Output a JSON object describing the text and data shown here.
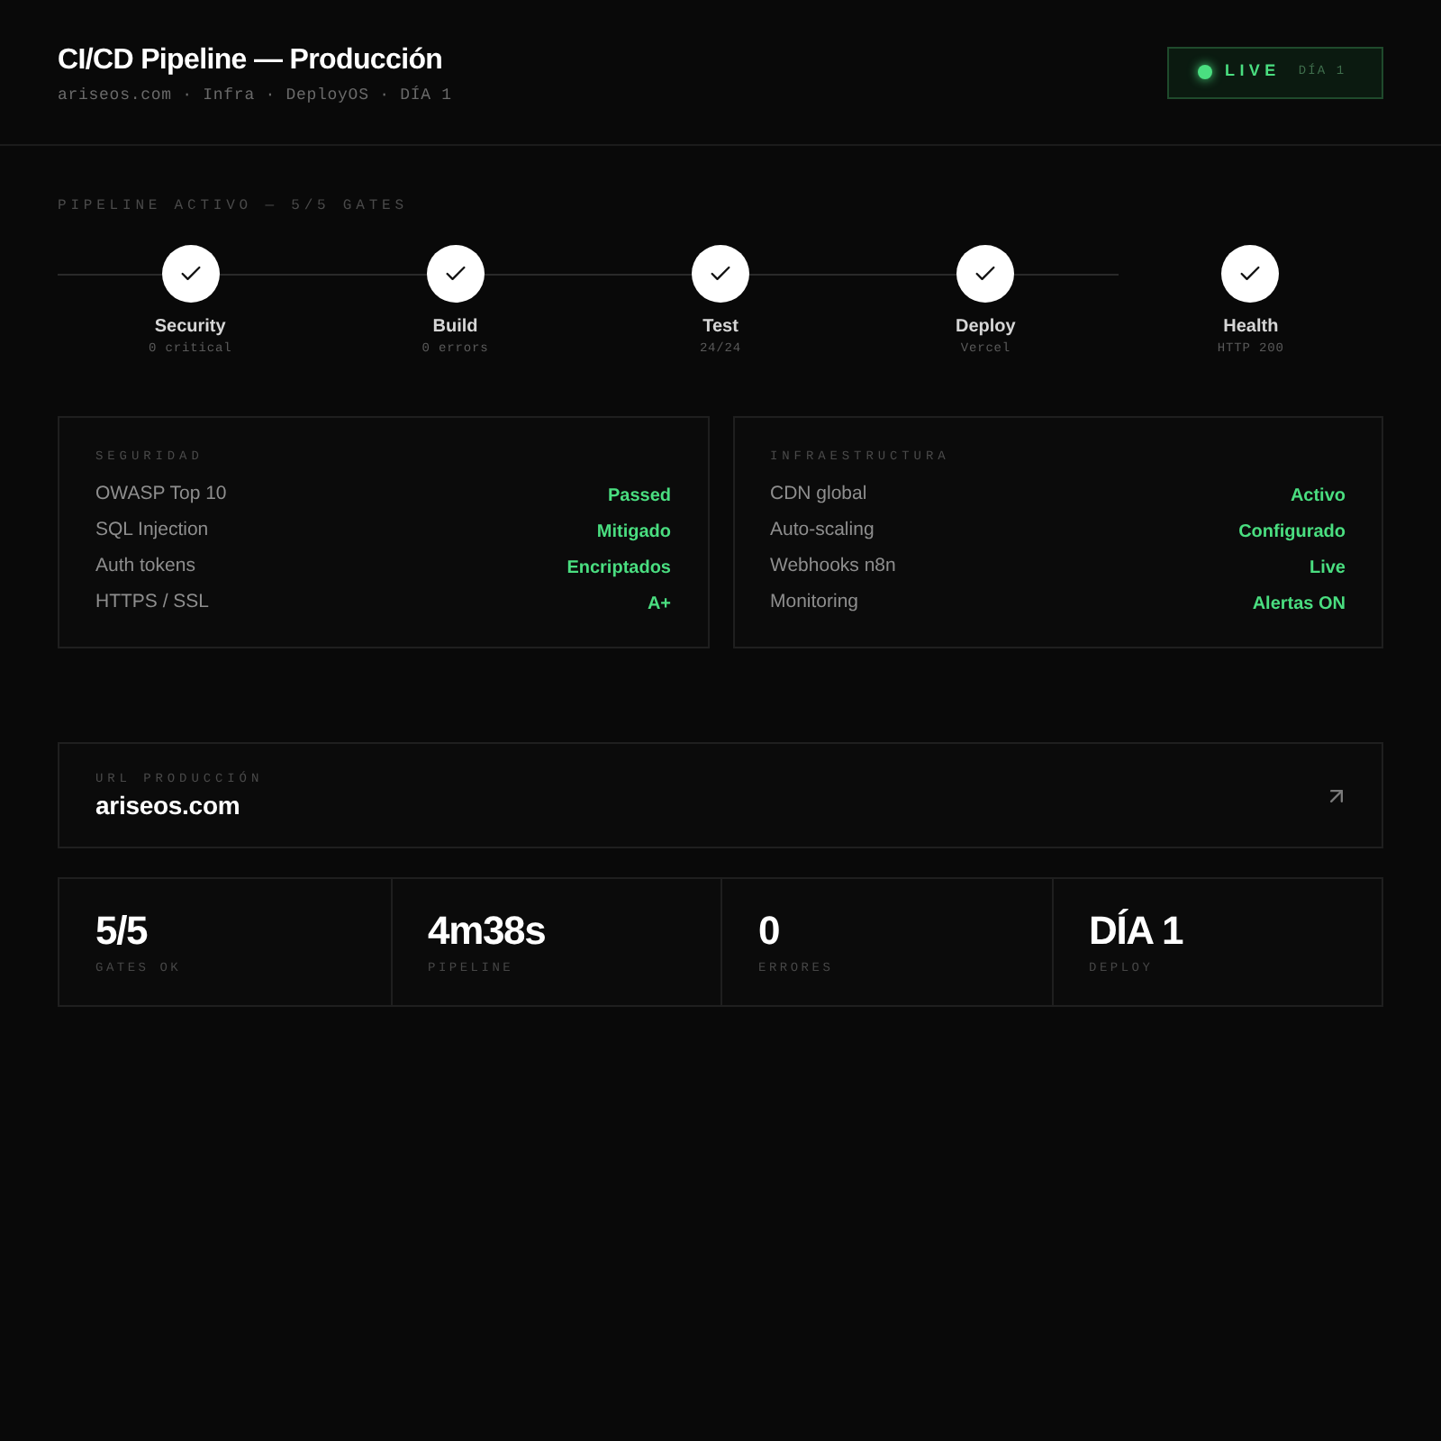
{
  "header": {
    "title": "CI/CD Pipeline — Producción",
    "subtitle": "ariseos.com · Infra · DeployOS · DÍA 1",
    "status_badge": {
      "label": "LIVE",
      "detail": "DÍA 1"
    }
  },
  "pipeline": {
    "heading": "PIPELINE ACTIVO — 5/5 GATES",
    "gates": [
      {
        "name": "Security",
        "detail": "0 critical",
        "passed": true
      },
      {
        "name": "Build",
        "detail": "0 errors",
        "passed": true
      },
      {
        "name": "Test",
        "detail": "24/24",
        "passed": true
      },
      {
        "name": "Deploy",
        "detail": "Vercel",
        "passed": true
      },
      {
        "name": "Health",
        "detail": "HTTP 200",
        "passed": true
      }
    ]
  },
  "panels": [
    {
      "title": "SEGURIDAD",
      "rows": [
        {
          "label": "OWASP Top 10",
          "value": "Passed"
        },
        {
          "label": "SQL Injection",
          "value": "Mitigado"
        },
        {
          "label": "Auth tokens",
          "value": "Encriptados"
        },
        {
          "label": "HTTPS / SSL",
          "value": "A+"
        }
      ]
    },
    {
      "title": "INFRAESTRUCTURA",
      "rows": [
        {
          "label": "CDN global",
          "value": "Activo"
        },
        {
          "label": "Auto-scaling",
          "value": "Configurado"
        },
        {
          "label": "Webhooks n8n",
          "value": "Live"
        },
        {
          "label": "Monitoring",
          "value": "Alertas ON"
        }
      ]
    }
  ],
  "production_url": {
    "label": "URL PRODUCCIÓN",
    "value": "ariseos.com"
  },
  "stats": [
    {
      "value": "5/5",
      "label": "GATES OK"
    },
    {
      "value": "4m38s",
      "label": "PIPELINE"
    },
    {
      "value": "0",
      "label": "ERRORES"
    },
    {
      "value": "DÍA 1",
      "label": "DEPLOY"
    }
  ]
}
